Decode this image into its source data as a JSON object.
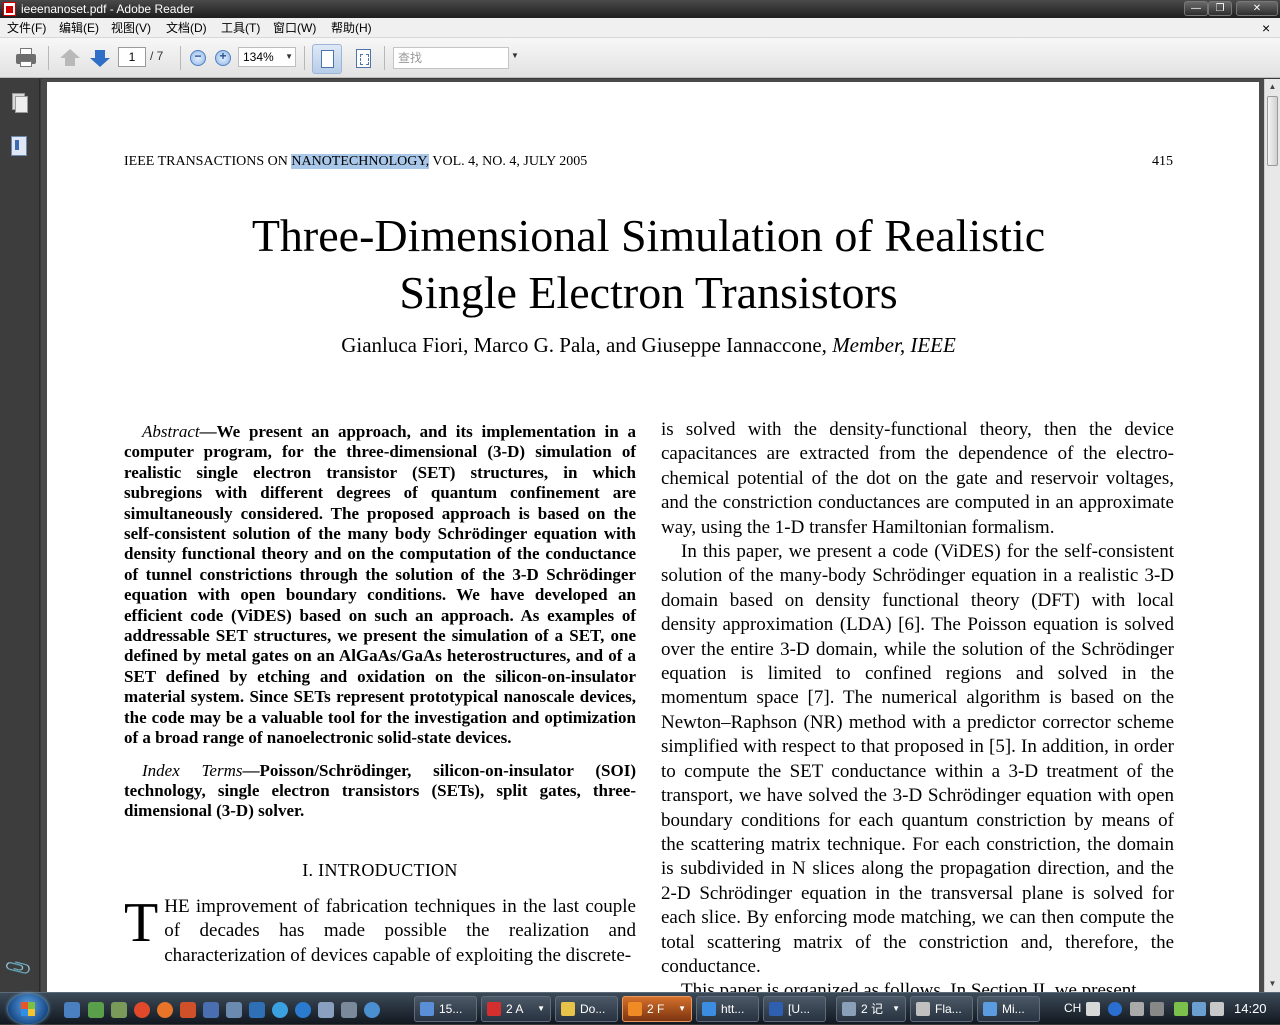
{
  "window": {
    "title": "ieeenanoset.pdf - Adobe Reader",
    "minimize": "—",
    "maximize": "❐",
    "close": "✕"
  },
  "menu": {
    "items": [
      "文件(F)",
      "编辑(E)",
      "视图(V)",
      "文档(D)",
      "工具(T)",
      "窗口(W)",
      "帮助(H)"
    ],
    "doc_close": "×"
  },
  "toolbar": {
    "page_current": "1",
    "page_total": "/ 7",
    "zoom_out": "−",
    "zoom_in": "+",
    "zoom_level": "134%",
    "search_placeholder": "查找"
  },
  "document": {
    "running_head_pre": "IEEE TRANSACTIONS ON ",
    "running_head_highlight": "NANOTECHNOLOGY,",
    "running_head_post": " VOL. 4, NO. 4, JULY 2005",
    "page_number": "415",
    "title_line1": "Three-Dimensional Simulation of Realistic",
    "title_line2": "Single Electron Transistors",
    "authors": "Gianluca Fiori, Marco G. Pala, and Giuseppe Iannaccone,",
    "authors_affiliation": "Member, IEEE",
    "abstract_label": "Abstract",
    "abstract_text": "—We present an approach, and its implementation in a computer program, for the three-dimensional (3-D) simulation of realistic single electron transistor (SET) structures, in which subregions with different degrees of quantum confinement are simultaneously considered. The proposed approach is based on the self-consistent solution of the many body Schrödinger equation with density functional theory and on the computation of the conductance of tunnel constrictions through the solution of the 3-D Schrödinger equation with open boundary conditions. We have developed an efficient code (ViDES) based on such an approach. As examples of addressable SET structures, we present the simulation of a SET, one defined by metal gates on an AlGaAs/GaAs heterostructures, and of a SET defined by etching and oxidation on the silicon-on-insulator material system. Since SETs represent prototypical nanoscale devices, the code may be a valuable tool for the investigation and optimization of a broad range of nanoelectronic solid-state devices.",
    "index_terms_label": "Index Terms",
    "index_terms_text": "—Poisson/Schrödinger, silicon-on-insulator (SOI) technology, single electron transistors (SETs), split gates, three-dimensional (3-D) solver.",
    "section_heading": "I. INTRODUCTION",
    "intro_dropcap": "T",
    "intro_text": "HE improvement of fabrication techniques in the last couple of decades has made possible the realization and characterization of devices capable of exploiting the discrete-",
    "right_para1": "is solved with the density-functional theory, then the device capacitances are extracted from the dependence of the electro-chemical potential of the dot on the gate and reservoir voltages, and the constriction conductances are computed in an approximate way, using the 1-D transfer Hamiltonian formalism.",
    "right_para2": "In this paper, we present a code (ViDES) for the self-consistent solution of the many-body Schrödinger equation in a realistic 3-D domain based on density functional theory (DFT) with local density approximation (LDA) [6]. The Poisson equation is solved over the entire 3-D domain, while the solution of the Schrödinger equation is limited to confined regions and solved in the momentum space [7]. The numerical algorithm is based on the Newton–Raphson (NR) method with a predictor corrector scheme simplified with respect to that proposed in [5]. In addition, in order to compute the SET conductance within a 3-D treatment of the transport, we have solved the 3-D Schrödinger equation with open boundary conditions for each quantum constriction by means of the scattering matrix technique. For each constriction, the domain is subdivided in N slices along the propagation direction, and the 2-D Schrödinger equation in the transversal plane is solved for each slice. By enforcing mode matching, we can then compute the total scattering matrix of the constriction and, therefore, the conductance.",
    "right_para3": "This paper is organized as follows. In Section II, we present"
  },
  "taskbar": {
    "buttons": [
      {
        "label": "15...",
        "color": "#5a8fd8"
      },
      {
        "label": "2 A",
        "color": "#d32f2f"
      },
      {
        "label": "Do...",
        "color": "#e8c34a"
      },
      {
        "label": "2 F",
        "color": "#f08a24"
      },
      {
        "label": "htt...",
        "color": "#3a8de0"
      },
      {
        "label": "[U...",
        "color": "#2f5fb0"
      },
      {
        "label": "2 记",
        "color": "#8aa0b8"
      },
      {
        "label": "Fla...",
        "color": "#c0c0c0"
      },
      {
        "label": "Mi...",
        "color": "#5b9be0"
      }
    ],
    "language": "CH",
    "clock": "14:20"
  }
}
